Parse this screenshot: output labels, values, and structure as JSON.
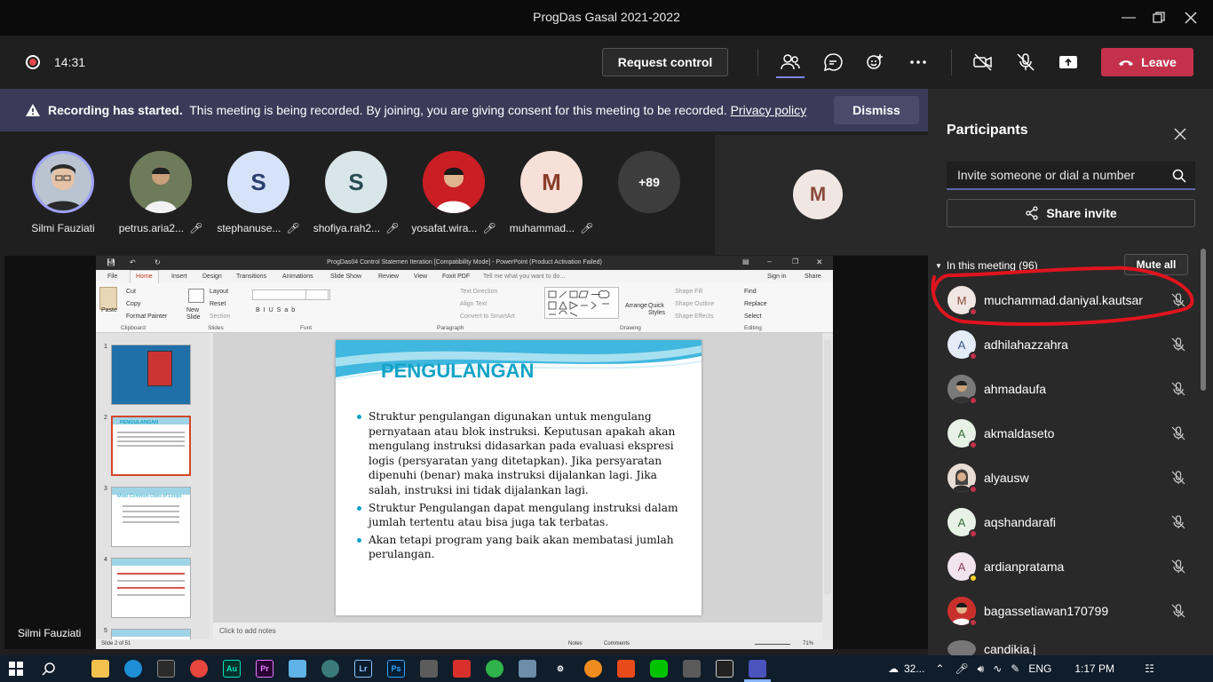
{
  "window": {
    "title": "ProgDas Gasal 2021-2022"
  },
  "toolbar": {
    "timer": "14:31",
    "request_control": "Request control",
    "leave": "Leave"
  },
  "banner": {
    "bold": "Recording has started.",
    "text": "This meeting is being recorded. By joining, you are giving consent for this meeting to be recorded.",
    "link": "Privacy policy",
    "dismiss": "Dismiss"
  },
  "gallery": {
    "tiles": [
      {
        "name": "Silmi Fauziati",
        "initial": ""
      },
      {
        "name": "petrus.aria2...",
        "initial": ""
      },
      {
        "name": "stephanuse...",
        "initial": "S"
      },
      {
        "name": "shofiya.rah2...",
        "initial": "S"
      },
      {
        "name": "yosafat.wira...",
        "initial": ""
      },
      {
        "name": "muhammad...",
        "initial": "M"
      }
    ],
    "more": "+89",
    "large_initial": "M"
  },
  "presenter": {
    "name": "Silmi Fauziati"
  },
  "powerpoint": {
    "title": "ProgDas04 Control Statemen  Iteration [Compatibility Mode] - PowerPoint (Product Activation Failed)",
    "tabs": [
      "File",
      "Home",
      "Insert",
      "Design",
      "Transitions",
      "Animations",
      "Slide Show",
      "Review",
      "View",
      "Foxit PDF"
    ],
    "tell_me": "Tell me what you want to do...",
    "sign_in": "Sign in",
    "share": "Share",
    "ribbon_groups": [
      "Clipboard",
      "Slides",
      "Font",
      "Paragraph",
      "Drawing",
      "Editing"
    ],
    "ribbon": {
      "paste": "Paste",
      "cut": "Cut",
      "copy": "Copy",
      "format_painter": "Format Painter",
      "new_slide": "New Slide",
      "layout": "Layout",
      "reset": "Reset",
      "section": "Section",
      "text_direction": "Text Direction",
      "align_text": "Align Text",
      "convert_smartart": "Convert to SmartArt",
      "arrange": "Arrange",
      "quick_styles": "Quick Styles",
      "shape_fill": "Shape Fill",
      "shape_outline": "Shape Outline",
      "shape_effects": "Shape Effects",
      "find": "Find",
      "replace": "Replace",
      "select": "Select"
    },
    "thumb_numbers": [
      "1",
      "2",
      "3",
      "4",
      "5"
    ],
    "thumb3_title": "Most Common Uses of Loops",
    "thumb2_title": "PENGULANGAN",
    "notes_placeholder": "Click to add notes",
    "status": {
      "slide": "Slide 2 of 51",
      "notes": "Notes",
      "comments": "Comments",
      "zoom": "71%"
    },
    "slide": {
      "title": "PENGULANGAN",
      "bullets": [
        "Struktur pengulangan digunakan untuk mengulang pernyataan atau blok instruksi. Keputusan apakah akan mengulang instruksi  didasarkan pada evaluasi ekspresi logis (persyaratan yang ditetapkan). Jika persyaratan dipenuhi (benar) maka instruksi dijalankan lagi. Jika salah, instruksi ini tidak dijalankan lagi.",
        "Struktur Pengulangan dapat mengulang instruksi dalam jumlah tertentu atau bisa juga tak terbatas.",
        "Akan tetapi program yang baik akan membatasi jumlah perulangan."
      ]
    }
  },
  "participants": {
    "title": "Participants",
    "invite_placeholder": "Invite someone or dial a number",
    "share_invite": "Share invite",
    "in_meeting": "In this meeting (96)",
    "mute_all": "Mute all",
    "list": [
      {
        "name": "muchammad.daniyal.kautsar",
        "initial": "M",
        "bg": "#f0e6e2",
        "fg": "#8a4b3b"
      },
      {
        "name": "adhilahazzahra",
        "initial": "A",
        "bg": "#e4ecf7",
        "fg": "#3b5a8a"
      },
      {
        "name": "ahmadaufa",
        "initial": "",
        "bg": "#6b6b6b",
        "fg": "#fff"
      },
      {
        "name": "akmaldaseto",
        "initial": "A",
        "bg": "#e6f2e4",
        "fg": "#3b6a3b"
      },
      {
        "name": "alyausw",
        "initial": "",
        "bg": "#a88b7a",
        "fg": "#fff"
      },
      {
        "name": "aqshandarafi",
        "initial": "A",
        "bg": "#e6f2e4",
        "fg": "#3b6a3b"
      },
      {
        "name": "ardianpratama",
        "initial": "A",
        "bg": "#f2e4ec",
        "fg": "#8a3b5a"
      },
      {
        "name": "bagassetiawan170799",
        "initial": "",
        "bg": "#c9302c",
        "fg": "#fff"
      }
    ],
    "partial_name": "candikia.j"
  },
  "taskbar": {
    "weather": "32...",
    "lang": "ENG",
    "clock": "1:17 PM",
    "apps": [
      "Au",
      "Pr",
      "Lr",
      "Ps"
    ]
  },
  "colors": {
    "accent": "#6264a7",
    "leave": "#c4314b",
    "banner": "#3b3a58",
    "slide_title": "#13a3c7",
    "annotation": "#e0141e"
  }
}
